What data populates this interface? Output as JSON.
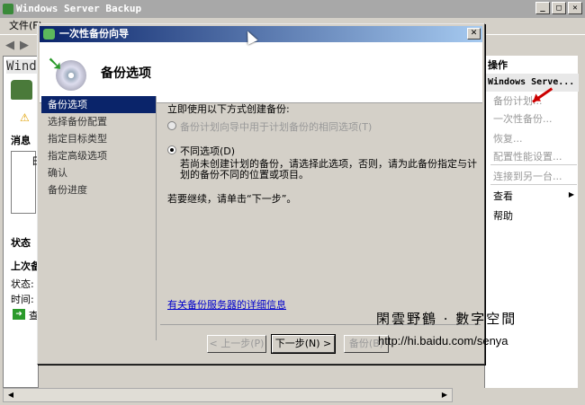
{
  "main_window": {
    "title": "Windows Server Backup",
    "menu_file": "文件(F)",
    "left_label": "Wind",
    "messages_label": "消息",
    "status_label": "状态",
    "last_backup_label": "上次备",
    "state_label": "状态:",
    "time_label": "时间:",
    "view_label": "查",
    "msg_col": "日"
  },
  "action_pane": {
    "header": "操作",
    "server": "Windows Serve...",
    "items": [
      {
        "label": "备份计划...",
        "enabled": false
      },
      {
        "label": "一次性备份...",
        "enabled": false
      },
      {
        "label": "恢复...",
        "enabled": false
      },
      {
        "label": "配置性能设置...",
        "enabled": false
      },
      {
        "label": "连接到另一台...",
        "enabled": false
      },
      {
        "label": "查看",
        "enabled": true
      },
      {
        "label": "帮助",
        "enabled": true
      }
    ]
  },
  "dialog": {
    "title": "一次性备份向导",
    "header_title": "备份选项",
    "steps": [
      "备份选项",
      "选择备份配置",
      "指定目标类型",
      "指定高级选项",
      "确认",
      "备份进度"
    ],
    "active_step": 0,
    "prompt": "立即使用以下方式创建备份:",
    "option1": "备份计划向导中用于计划备份的相同选项(T)",
    "option2": "不同选项(D)",
    "description": "若尚未创建计划的备份，请选择此选项，否则，请为此备份指定与计划的备份不同的位置或项目。",
    "continue_text": "若要继续，请单击“下一步”。",
    "link_text": "有关备份服务器的详细信息",
    "buttons": {
      "back": "< 上一步(P)",
      "next": "下一步(N) >",
      "backup": "备份(B)"
    }
  },
  "watermark": {
    "text": "閑雲野鶴 · 數字空間",
    "url": "http://hi.baidu.com/senya"
  }
}
